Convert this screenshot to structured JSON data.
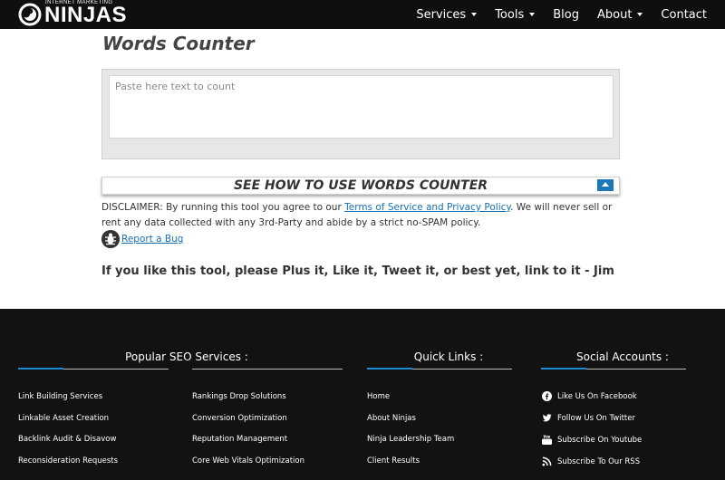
{
  "nav": {
    "logo_small": "INTERNET MARKETING",
    "logo_big": "NINJAS",
    "items": [
      {
        "label": "Services",
        "has_dropdown": true
      },
      {
        "label": "Tools",
        "has_dropdown": true
      },
      {
        "label": "Blog",
        "has_dropdown": false
      },
      {
        "label": "About",
        "has_dropdown": true
      },
      {
        "label": "Contact",
        "has_dropdown": false
      }
    ]
  },
  "main": {
    "title": "Words Counter",
    "textarea_placeholder": "Paste here text to count",
    "howto_label": "SEE HOW TO USE WORDS COUNTER",
    "disclaimer_pre": "DISCLAIMER: By running this tool you agree to our ",
    "disclaimer_link": "Terms of Service and Privacy Policy",
    "disclaimer_post": ". We will never sell or rent any data collected with any 3rd-Party and abide by a strict no-SPAM policy.",
    "bug_link": "Report a Bug",
    "plus_line": "If you like this tool, please Plus it, Like it, Tweet it, or best yet, link to it - Jim"
  },
  "footer": {
    "popular_heading": "Popular SEO Services :",
    "quick_heading": "Quick Links :",
    "social_heading": "Social Accounts :",
    "popular_col1": [
      "Link Building Services",
      "Linkable Asset Creation",
      "Backlink Audit & Disavow",
      "Reconsideration Requests"
    ],
    "popular_col2": [
      "Rankings Drop Solutions",
      "Conversion Optimization",
      "Reputation Management",
      "Core Web Vitals Optimization"
    ],
    "quick_links": [
      "Home",
      "About Ninjas",
      "Ninja Leadership Team",
      "Client Results"
    ],
    "social_links": [
      {
        "label": "Like Us On Facebook",
        "icon": "facebook-icon"
      },
      {
        "label": "Follow Us On Twitter",
        "icon": "twitter-icon"
      },
      {
        "label": "Subscribe On Youtube",
        "icon": "youtube-icon"
      },
      {
        "label": "Subscribe To Our RSS",
        "icon": "rss-icon"
      }
    ]
  },
  "colors": {
    "nav_bg": "#0f0f0f",
    "footer_bg": "#121212",
    "accent": "#1a8ad4",
    "link": "#1a6fb3"
  }
}
